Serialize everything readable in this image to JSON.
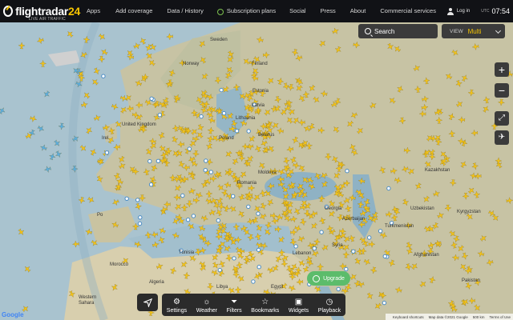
{
  "topbar": {
    "logo_main": "flightradar",
    "logo_num": "24",
    "logo_sub": "LIVE AIR TRAFFIC",
    "nav": [
      "Apps",
      "Add coverage",
      "Data / History",
      "Subscription plans",
      "Social",
      "Press",
      "About",
      "Commercial services"
    ],
    "login": "Log in",
    "timezone": "UTC",
    "time": "07:54"
  },
  "search": {
    "label": "Search"
  },
  "view": {
    "label": "VIEW",
    "value": "Multi"
  },
  "bottombar": {
    "items": [
      {
        "label": "Settings",
        "icon": "gear-icon"
      },
      {
        "label": "Weather",
        "icon": "weather-icon"
      },
      {
        "label": "Filters",
        "icon": "filter-icon"
      },
      {
        "label": "Bookmarks",
        "icon": "star-icon"
      },
      {
        "label": "Widgets",
        "icon": "widgets-icon"
      },
      {
        "label": "Playback",
        "icon": "clock-icon"
      }
    ]
  },
  "upgrade": {
    "label": "Upgrade"
  },
  "attribution": {
    "shortcuts": "Keyboard shortcuts",
    "mapdata": "Map data ©2021 Google",
    "scale": "500 km",
    "terms": "Terms of Use"
  },
  "google": "Google",
  "map_labels": {
    "sweden": "Sweden",
    "norway": "Norway",
    "finland": "Finland",
    "estonia": "Estonia",
    "latvia": "Latvia",
    "lithuania": "Lithuania",
    "belarus": "Belarus",
    "uk": "United Kingdom",
    "ireland": "Irel",
    "poland": "Poland",
    "moldova": "Moldova",
    "romania": "Romania",
    "kazakhstan": "Kazakhstan",
    "uzbekistan": "Uzbekistan",
    "kyrgyzstan": "Kyrgyzstan",
    "turkmenistan": "Turkmenistan",
    "georgia": "Georgia",
    "azerbaijan": "Azerbaijan",
    "afghanistan": "Afghanistan",
    "tunisia": "Tunisia",
    "algeria": "Algeria",
    "libya": "Libya",
    "morocco": "Morocco",
    "western_sahara": "Western Sahara",
    "syria": "Syria",
    "lebanon": "Lebanon",
    "egypt": "Egypt",
    "pakistan": "Pakistan",
    "portugal": "Po"
  },
  "colors": {
    "plane": "#f2c21a",
    "plane_blue": "#5aaee0",
    "land": "#c9c5a7",
    "sea": "#a9c3cf",
    "accent": "#f5c400"
  }
}
